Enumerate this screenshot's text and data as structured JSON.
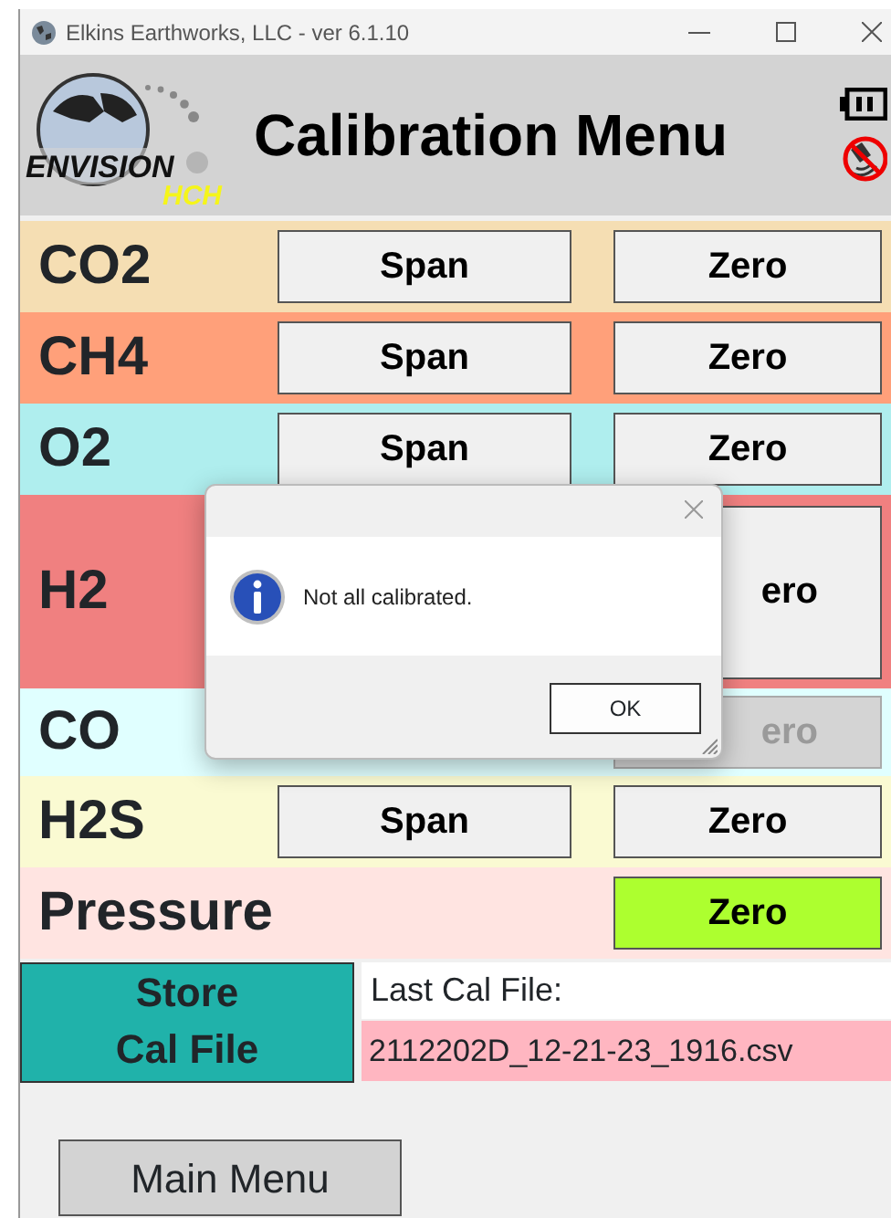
{
  "window": {
    "title": "Elkins Earthworks, LLC - ver 6.1.10"
  },
  "header": {
    "logo_word": "ENVISION",
    "logo_sub": "HCH",
    "title": "Calibration Menu"
  },
  "rows": [
    {
      "gas": "CO2",
      "color": "#f5deb3",
      "span": {
        "label": "Span"
      },
      "zero": {
        "label": "Zero",
        "disabled": false,
        "calibrated": false
      }
    },
    {
      "gas": "CH4",
      "color": "#ffa07a",
      "span": {
        "label": "Span"
      },
      "zero": {
        "label": "Zero",
        "disabled": false,
        "calibrated": false
      }
    },
    {
      "gas": "O2",
      "color": "#afeeee",
      "span": {
        "label": "Span"
      },
      "zero": {
        "label": "Zero",
        "disabled": false,
        "calibrated": false
      }
    },
    {
      "gas": "H2",
      "color": "#f08080",
      "tall": true,
      "zero": {
        "label": "ero",
        "disabled": false,
        "calibrated": false
      }
    },
    {
      "gas": "CO",
      "color": "#e0ffff",
      "zero": {
        "label": "ero",
        "disabled": true,
        "calibrated": false
      }
    },
    {
      "gas": "H2S",
      "color": "#fafad2",
      "span": {
        "label": "Span"
      },
      "zero": {
        "label": "Zero",
        "disabled": false,
        "calibrated": false
      }
    },
    {
      "gas": "Pressure",
      "color": "#ffe4e1",
      "zero": {
        "label": "Zero",
        "disabled": false,
        "calibrated": true
      }
    }
  ],
  "store_button": [
    "Store",
    "Cal File"
  ],
  "last_cal": {
    "label": "Last Cal File:",
    "file": "2112202D_12-21-23_1916.csv"
  },
  "main_menu": "Main Menu",
  "dialog": {
    "message": "Not all calibrated.",
    "ok": "OK"
  }
}
